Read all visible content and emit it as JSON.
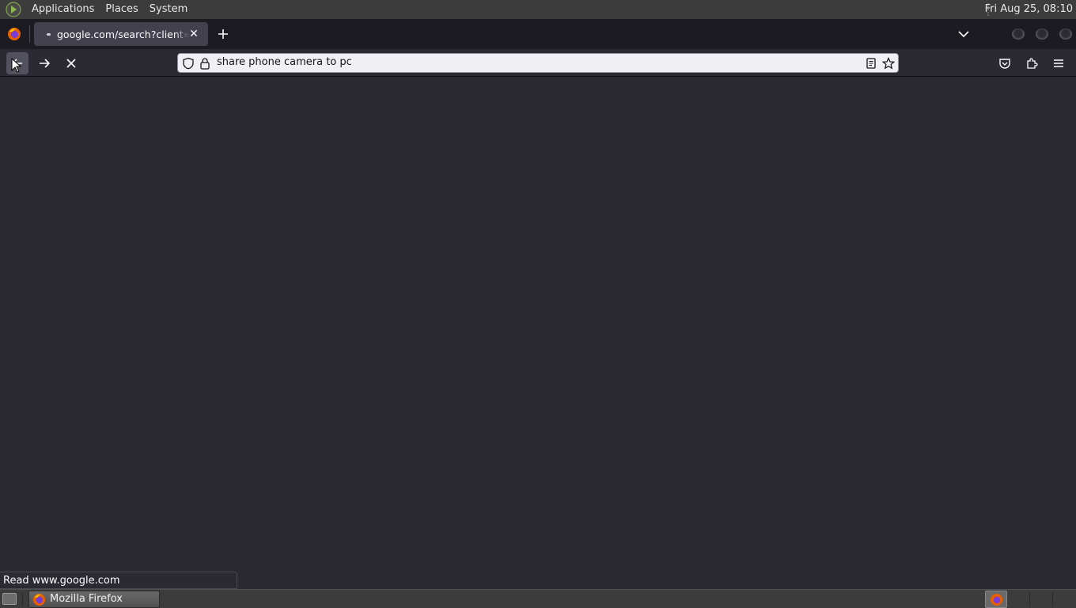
{
  "top_panel": {
    "menus": [
      "Applications",
      "Places",
      "System"
    ],
    "clock": "Fri Aug 25, 08:10"
  },
  "browser": {
    "active_tab": {
      "title": "google.com/search?client=firefox-b-e&q=share+phone+camera+to+pc"
    },
    "url_bar": {
      "value": "share phone camera to pc"
    },
    "status_text": "Read www.google.com"
  },
  "taskbar": {
    "window_title": "Mozilla Firefox"
  },
  "colors": {
    "content_bg": "#2b2a33",
    "tab_strip_bg": "#1c1b22",
    "active_tab_bg": "#42414d",
    "url_bar_bg": "#f0f0f4",
    "panel_bg": "#3c3c3c"
  }
}
